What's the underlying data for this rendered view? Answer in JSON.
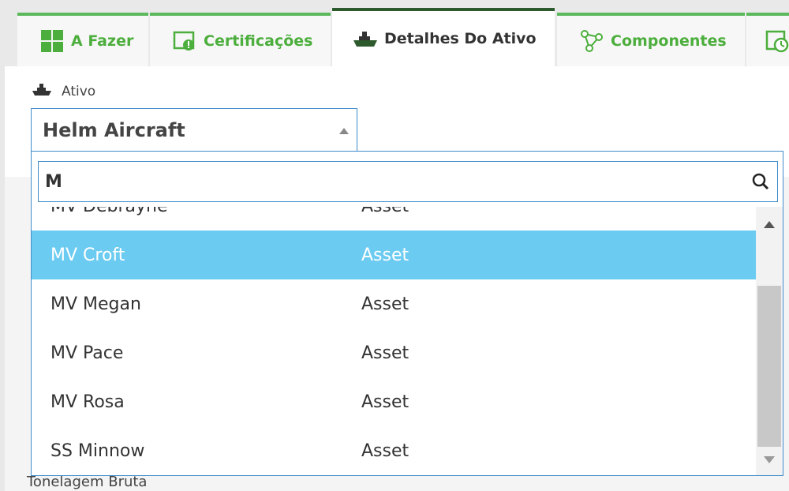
{
  "tabs": [
    {
      "label": "A Fazer",
      "icon": "grid-icon"
    },
    {
      "label": "Certificações",
      "icon": "certificate-icon"
    },
    {
      "label": "Detalhes Do Ativo",
      "icon": "ship-icon",
      "active": true
    },
    {
      "label": "Componentes",
      "icon": "components-icon"
    },
    {
      "label": "",
      "icon": "schedule-icon"
    }
  ],
  "asset_field": {
    "label": "Ativo",
    "selected": "Helm Aircraft"
  },
  "dropdown": {
    "search_value": "M",
    "rows": [
      {
        "name": "MV Debrayne",
        "type": "Asset"
      },
      {
        "name": "MV Croft",
        "type": "Asset",
        "selected": true
      },
      {
        "name": "MV Megan",
        "type": "Asset"
      },
      {
        "name": "MV Pace",
        "type": "Asset"
      },
      {
        "name": "MV Rosa",
        "type": "Asset"
      },
      {
        "name": "SS Minnow",
        "type": "Asset"
      }
    ]
  },
  "background_fields": {
    "bottom_label": "Tonelagem Bruta"
  },
  "colors": {
    "tab_green": "#5cb85c",
    "active_tab_border": "#2d5a2d",
    "selection_blue": "#6bcbf1",
    "focus_border": "#3f8ccb"
  }
}
